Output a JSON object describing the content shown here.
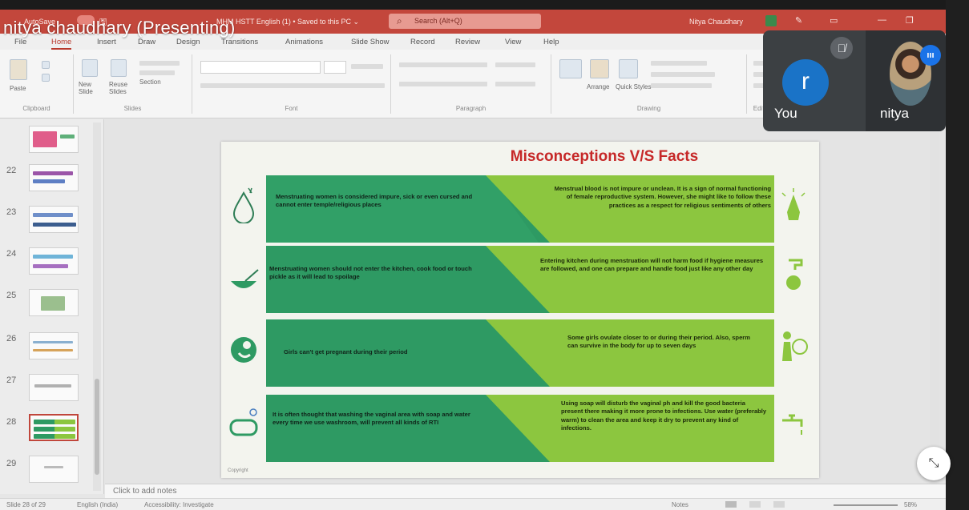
{
  "presenter_banner": "nitya chaudhary (Presenting)",
  "ppt": {
    "window_title": "MHM HSTT English (1) • Saved to this PC ⌄",
    "autosave": "AutoSave",
    "search_placeholder": "Search (Alt+Q)",
    "user_name": "Nitya Chaudhary",
    "menu": [
      "File",
      "Home",
      "Insert",
      "Draw",
      "Design",
      "Transitions",
      "Animations",
      "Slide Show",
      "Record",
      "Review",
      "View",
      "Help"
    ],
    "ribbon_groups": [
      "Clipboard",
      "Slides",
      "Font",
      "Paragraph",
      "Drawing",
      "Editing"
    ],
    "ribbon_buttons": {
      "paste": "Paste",
      "new_slide": "New Slide",
      "reuse_slides": "Reuse Slides",
      "section": "Section",
      "arrange": "Arrange",
      "quick_styles": "Quick Styles"
    },
    "thumbnails": [
      {
        "num": "",
        "selected": false
      },
      {
        "num": "22",
        "selected": false
      },
      {
        "num": "23",
        "selected": false
      },
      {
        "num": "24",
        "selected": false
      },
      {
        "num": "25",
        "selected": false
      },
      {
        "num": "26",
        "selected": false
      },
      {
        "num": "27",
        "selected": false
      },
      {
        "num": "28",
        "selected": true
      },
      {
        "num": "29",
        "selected": false
      }
    ],
    "notes_placeholder": "Click to add notes",
    "status": {
      "slide_count": "Slide 28 of 29",
      "language": "English (India)",
      "accessibility": "Accessibility: Investigate",
      "notes": "Notes",
      "zoom": "58%"
    }
  },
  "slide": {
    "title": "Misconceptions V/S Facts",
    "rows": [
      {
        "myth": "Menstruating women is considered impure, sick or even cursed and cannot enter temple/religious places",
        "fact": "Menstrual blood is not impure or unclean. It is a sign of normal functioning of female reproductive system. However, she might like to follow these practices as a respect for religious sentiments of others",
        "left_icon": "drop-icon",
        "right_icon": "praying-hands-icon"
      },
      {
        "myth": "Menstruating women should not enter the kitchen, cook food or touch pickle as it will lead to spoilage",
        "fact": "Entering kitchen during menstruation will not harm food if hygiene measures are followed, and one can prepare and handle food just like any other day",
        "left_icon": "bowl-icon",
        "right_icon": "tap-washing-icon"
      },
      {
        "myth": "Girls can't get pregnant during their period",
        "fact": "Some girls ovulate closer to or during their period. Also, sperm can survive in the body for up to seven days",
        "left_icon": "fetus-icon",
        "right_icon": "pregnancy-icon"
      },
      {
        "myth": "It is often thought that washing the vaginal area with soap and water every time we use washroom, will prevent all kinds of RTI",
        "fact": "Using soap will disturb the vaginal ph and kill the good bacteria present there making it more prone to infections. Use water (preferably warm) to clean the area and keep it dry to prevent any kind of infections.",
        "left_icon": "soap-icon",
        "right_icon": "water-tap-icon"
      }
    ],
    "copyright": "Copyright"
  },
  "meet": {
    "self_label": "You",
    "self_initial": "r",
    "other_label": "nitya"
  },
  "colors": {
    "title_bar": "#c3473c",
    "myth_green": "#2e9a63",
    "fact_green": "#8cc63f",
    "slide_title": "#c62828"
  }
}
